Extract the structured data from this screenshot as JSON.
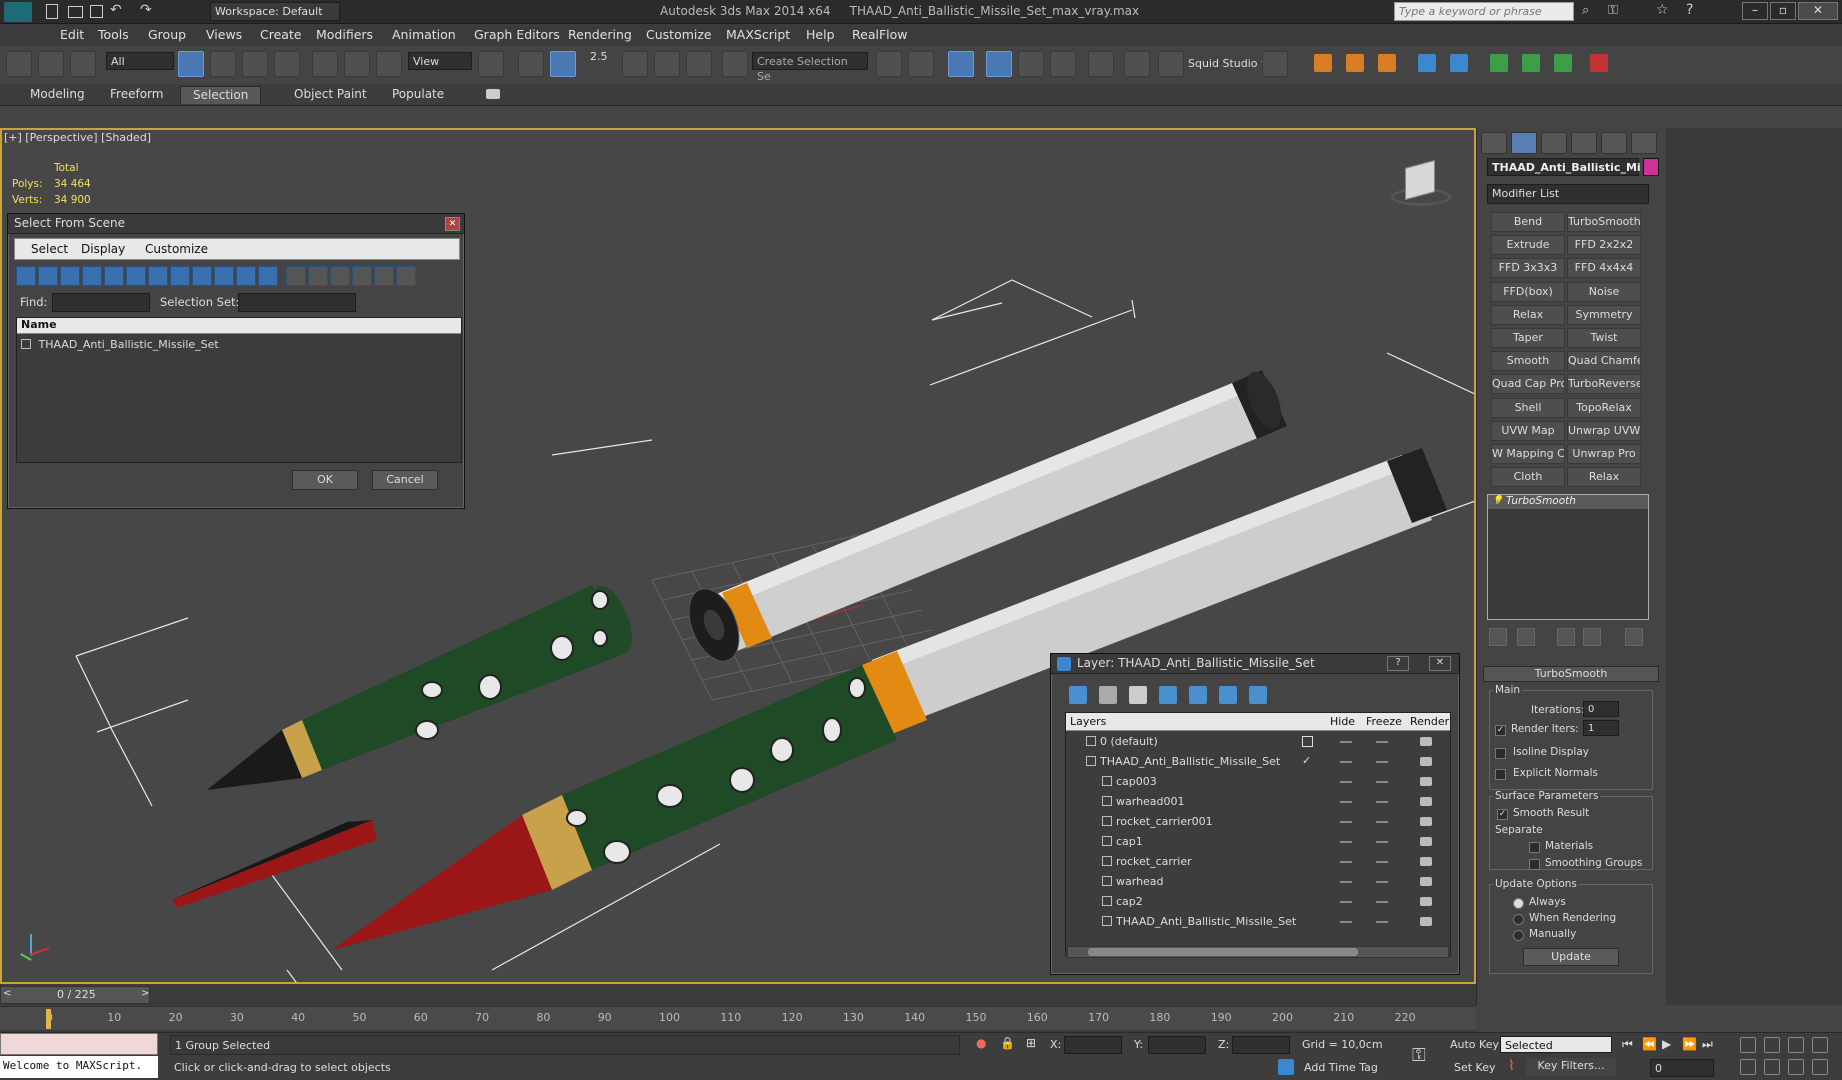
{
  "app": {
    "title": "Autodesk 3ds Max 2014 x64",
    "file": "THAAD_Anti_Ballistic_Missile_Set_max_vray.max",
    "workspace": "Workspace: Default",
    "search_placeholder": "Type a keyword or phrase"
  },
  "menu": [
    "Edit",
    "Tools",
    "Group",
    "Views",
    "Create",
    "Modifiers",
    "Animation",
    "Graph Editors",
    "Rendering",
    "Customize",
    "MAXScript",
    "Help",
    "RealFlow"
  ],
  "toolbar": {
    "filter": "All",
    "refcoord": "View",
    "snap_label": "2.5",
    "selection_set_placeholder": "Create Selection Se",
    "squid": "Squid Studio v"
  },
  "ribbon": {
    "tabs": [
      "Modeling",
      "Freeform",
      "Selection",
      "Object Paint",
      "Populate"
    ],
    "active": "Selection"
  },
  "viewport": {
    "label": "[+] [Perspective] [Shaded]",
    "stats": {
      "header": "Total",
      "polys_label": "Polys:",
      "polys": "34 464",
      "verts_label": "Verts:",
      "verts": "34 900"
    }
  },
  "select_dialog": {
    "title": "Select From Scene",
    "menu": [
      "Select",
      "Display",
      "Customize"
    ],
    "find_label": "Find:",
    "selset_label": "Selection Set:",
    "column_name": "Name",
    "items": [
      "THAAD_Anti_Ballistic_Missile_Set"
    ],
    "ok": "OK",
    "cancel": "Cancel"
  },
  "layer_dialog": {
    "title": "Layer: THAAD_Anti_Ballistic_Missile_Set",
    "help": "?",
    "columns": {
      "layers": "Layers",
      "hide": "Hide",
      "freeze": "Freeze",
      "render": "Render"
    },
    "rows": [
      "0 (default)",
      "THAAD_Anti_Ballistic_Missile_Set",
      "cap003",
      "warhead001",
      "rocket_carrier001",
      "cap1",
      "rocket_carrier",
      "warhead",
      "cap2",
      "THAAD_Anti_Ballistic_Missile_Set"
    ]
  },
  "command_panel": {
    "object_name": "THAAD_Anti_Ballistic_Mi",
    "object_color": "#d0309a",
    "modifier_list": "Modifier List",
    "modifier_buttons": [
      "Bend",
      "TurboSmooth",
      "Extrude",
      "FFD 2x2x2",
      "FFD 3x3x3",
      "FFD 4x4x4",
      "FFD(box)",
      "Noise",
      "Relax",
      "Symmetry",
      "Taper",
      "Twist",
      "Smooth",
      "Quad Chamfer",
      "Quad Cap Pro",
      "TurboReverse",
      "Shell",
      "TopoRelax",
      "UVW Map",
      "Unwrap UVW",
      "W Mapping Cle",
      "Unwrap Pro",
      "Cloth",
      "Relax"
    ],
    "stack_item": "TurboSmooth",
    "turbosmooth": {
      "rollout": "TurboSmooth",
      "main": "Main",
      "iterations_label": "Iterations:",
      "iterations": "0",
      "render_iters_label": "Render Iters:",
      "render_iters": "1",
      "isoline": "Isoline Display",
      "explicit": "Explicit Normals",
      "surface": "Surface Parameters",
      "smooth_result": "Smooth Result",
      "separate": "Separate",
      "materials": "Materials",
      "smoothing_groups": "Smoothing Groups",
      "update_options": "Update Options",
      "always": "Always",
      "when_rendering": "When Rendering",
      "manually": "Manually",
      "update": "Update"
    }
  },
  "timeline": {
    "frame": "0 / 225",
    "ticks": [
      "0",
      "10",
      "20",
      "30",
      "40",
      "50",
      "60",
      "70",
      "80",
      "90",
      "100",
      "110",
      "120",
      "130",
      "140",
      "150",
      "160",
      "170",
      "180",
      "190",
      "200",
      "210",
      "220"
    ]
  },
  "status": {
    "maxscript": "Welcome to MAXScript.",
    "selected": "1 Group Selected",
    "hint": "Click or click-and-drag to select objects",
    "x": "X:",
    "y": "Y:",
    "z": "Z:",
    "grid": "Grid = 10,0cm",
    "add_time_tag": "Add Time Tag",
    "auto_key": "Auto Key",
    "set_key": "Set Key",
    "key_mode": "Selected",
    "key_filters": "Key Filters...",
    "current_frame": "0"
  }
}
